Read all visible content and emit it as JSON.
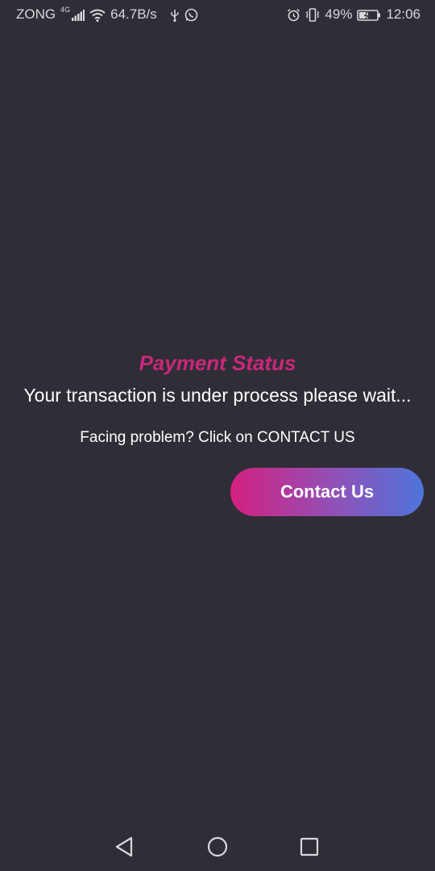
{
  "status_bar": {
    "carrier": "ZONG",
    "network_gen": "4G",
    "speed": "64.7B/s",
    "battery": "49%",
    "time": "12:06",
    "icons": [
      "signal-icon",
      "wifi-icon",
      "usb-icon",
      "whatsapp-icon",
      "alarm-icon",
      "vibrate-icon",
      "battery-icon"
    ]
  },
  "main": {
    "title": "Payment Status",
    "message": "Your transaction is under process please wait...",
    "hint": "Facing problem? Click on CONTACT US",
    "contact_button": "Contact Us"
  },
  "colors": {
    "background": "#2f2d36",
    "title": "#c9277a",
    "button_gradient_start": "#d4207f",
    "button_gradient_end": "#4e74db"
  },
  "nav_bar": {
    "icons": [
      "back-icon",
      "home-icon",
      "recent-apps-icon"
    ]
  }
}
